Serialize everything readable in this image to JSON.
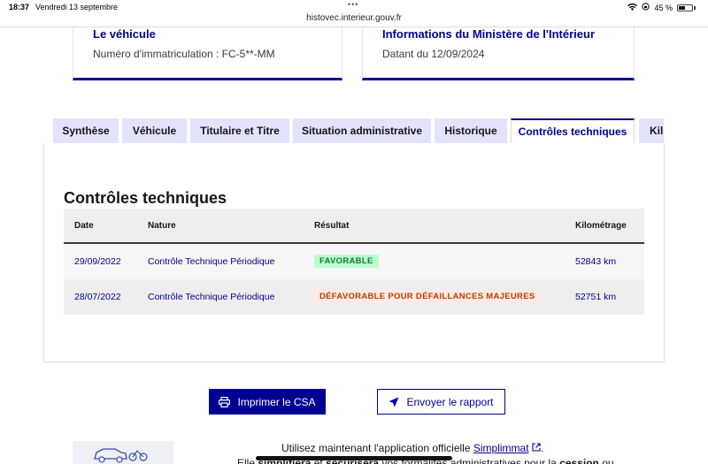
{
  "statusbar": {
    "time": "18:37",
    "date": "Vendredi 13 septembre",
    "url": "histovec.interieur.gouv.fr",
    "battery": "45 %"
  },
  "cards": [
    {
      "title": "Le véhicule",
      "value": "Numéro d'immatriculation : FC-5**-MM"
    },
    {
      "title": "Informations du Ministère de l'Intérieur",
      "value": "Datant du 12/09/2024"
    }
  ],
  "tabs": [
    {
      "label": "Synthèse",
      "active": false
    },
    {
      "label": "Véhicule",
      "active": false
    },
    {
      "label": "Titulaire et Titre",
      "active": false
    },
    {
      "label": "Situation administrative",
      "active": false
    },
    {
      "label": "Historique",
      "active": false
    },
    {
      "label": "Contrôles techniques",
      "active": true
    },
    {
      "label": "Kilo",
      "active": false
    }
  ],
  "section": {
    "title": "Contrôles techniques",
    "columns": [
      "Date",
      "Nature",
      "Résultat",
      "Kilométrage"
    ],
    "rows": [
      {
        "date": "29/09/2022",
        "nature": "Contrôle Technique Périodique",
        "result": "FAVORABLE",
        "status": "success",
        "km": "52843 km"
      },
      {
        "date": "28/07/2022",
        "nature": "Contrôle Technique Périodique",
        "result": "DÉFAVORABLE POUR DÉFAILLANCES MAJEURES",
        "status": "warning",
        "km": "52751 km"
      }
    ]
  },
  "actions": {
    "print_label": "Imprimer le CSA",
    "print_icon": "printer-icon",
    "send_label": "Envoyer le rapport",
    "send_icon": "paper-plane-icon"
  },
  "promo": {
    "line1_prefix": "Utilisez maintenant l'application officielle",
    "link": "Simplimmat",
    "line1_suffix": ".",
    "line2_a": "Elle ",
    "line2_b": "simplifiera",
    "line2_c": " et ",
    "line2_d": "sécurisera",
    "line2_e": " vos formalités administratives pour la ",
    "line2_f": "cession",
    "line2_g": " ou"
  },
  "colors": {
    "accent": "#000091",
    "tab_bg": "#e3e3fd",
    "success_bg": "#b8fec9",
    "success_fg": "#18753c",
    "warning_bg": "#ffe9e6",
    "warning_fg": "#b34000"
  }
}
